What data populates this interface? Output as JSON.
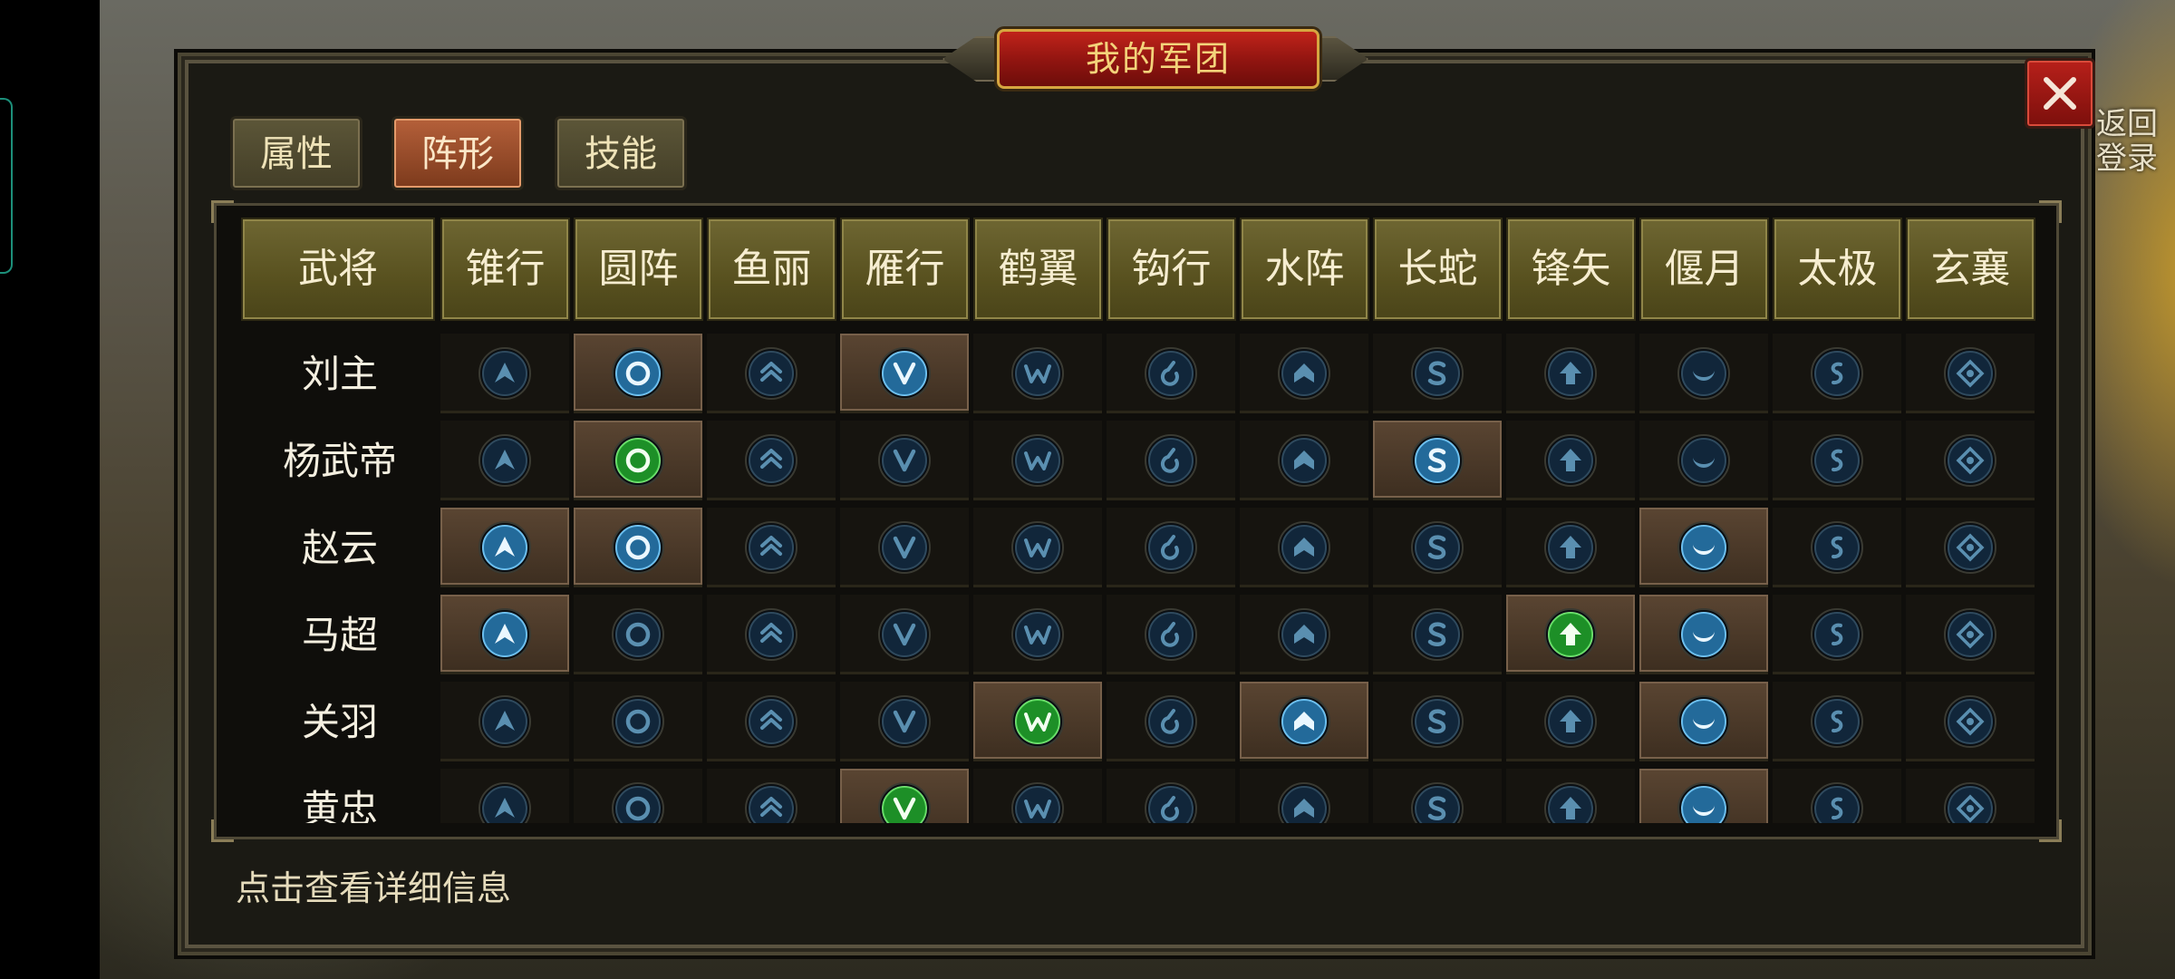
{
  "title": "我的军团",
  "background_return_text": "返回\n登录",
  "tabs": [
    {
      "label": "属性",
      "active": false
    },
    {
      "label": "阵形",
      "active": true
    },
    {
      "label": "技能",
      "active": false
    }
  ],
  "table": {
    "name_header": "武将",
    "formations": [
      {
        "label": "锥行",
        "glyph": "chevron"
      },
      {
        "label": "圆阵",
        "glyph": "ring"
      },
      {
        "label": "鱼丽",
        "glyph": "double-chevron"
      },
      {
        "label": "雁行",
        "glyph": "v"
      },
      {
        "label": "鹤翼",
        "glyph": "w"
      },
      {
        "label": "钩行",
        "glyph": "hook"
      },
      {
        "label": "水阵",
        "glyph": "house"
      },
      {
        "label": "长蛇",
        "glyph": "s"
      },
      {
        "label": "锋矢",
        "glyph": "arrow"
      },
      {
        "label": "偃月",
        "glyph": "crescent"
      },
      {
        "label": "太极",
        "glyph": "taiji"
      },
      {
        "label": "玄襄",
        "glyph": "diamond"
      }
    ],
    "rows": [
      {
        "name": "刘主",
        "cells": [
          "dim",
          "active",
          "dim",
          "active",
          "dim",
          "dim",
          "dim",
          "dim",
          "dim",
          "dim",
          "dim",
          "dim"
        ],
        "selected": [
          1,
          3
        ]
      },
      {
        "name": "杨武帝",
        "cells": [
          "dim",
          "green",
          "dim",
          "dim",
          "dim",
          "dim",
          "dim",
          "active",
          "dim",
          "dim",
          "dim",
          "dim"
        ],
        "selected": [
          1,
          7
        ]
      },
      {
        "name": "赵云",
        "cells": [
          "active",
          "active",
          "dim",
          "dim",
          "dim",
          "dim",
          "dim",
          "dim",
          "dim",
          "active",
          "dim",
          "dim"
        ],
        "selected": [
          0,
          1,
          9
        ]
      },
      {
        "name": "马超",
        "cells": [
          "active",
          "dim",
          "dim",
          "dim",
          "dim",
          "dim",
          "dim",
          "dim",
          "green",
          "active",
          "dim",
          "dim"
        ],
        "selected": [
          0,
          8,
          9
        ]
      },
      {
        "name": "关羽",
        "cells": [
          "dim",
          "dim",
          "dim",
          "dim",
          "green",
          "dim",
          "active",
          "dim",
          "dim",
          "active",
          "dim",
          "dim"
        ],
        "selected": [
          4,
          6,
          9
        ]
      },
      {
        "name": "黄忠",
        "cells": [
          "dim",
          "dim",
          "dim",
          "green",
          "dim",
          "dim",
          "dim",
          "dim",
          "dim",
          "active",
          "dim",
          "dim"
        ],
        "selected": [
          3,
          9
        ]
      }
    ]
  },
  "footer_hint": "点击查看详细信息",
  "colors": {
    "icon_dim": "#21425a",
    "icon_active": "#2c8fd0",
    "icon_green": "#22b23a",
    "title_red": "#b01c15",
    "gold_text": "#f3d37a"
  }
}
